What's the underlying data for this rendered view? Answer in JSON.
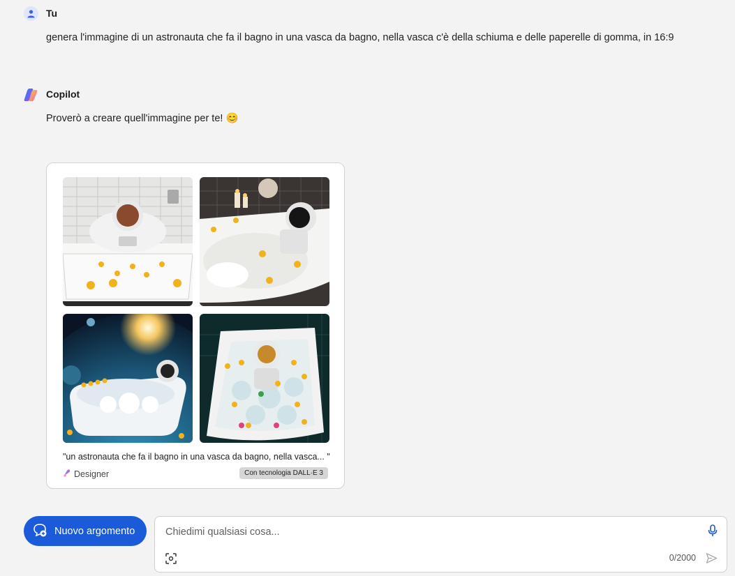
{
  "user_message": {
    "sender": "Tu",
    "text": "genera l'immagine di un astronauta che fa il bagno in una vasca da bagno, nella vasca c'è della schiuma e delle paperelle di gomma, in 16:9"
  },
  "copilot_message": {
    "sender": "Copilot",
    "text": "Proverò a creare quell'immagine per te! 😊"
  },
  "image_card": {
    "caption": "\"un astronauta che fa il bagno in una vasca da bagno, nella vasca... \"",
    "designer_label": "Designer",
    "badge": "Con tecnologia DALL·E 3"
  },
  "new_topic_button": {
    "label": "Nuovo argomento"
  },
  "chat_input": {
    "placeholder": "Chiedimi qualsiasi cosa...",
    "counter": "0/2000"
  },
  "colors": {
    "accent": "#1b5bd9",
    "background": "#f3f3f3",
    "card": "#ffffff"
  },
  "icons": [
    "user-avatar-icon",
    "copilot-logo-icon",
    "designer-icon",
    "new-topic-icon",
    "mic-icon",
    "image-scan-icon",
    "send-icon"
  ]
}
